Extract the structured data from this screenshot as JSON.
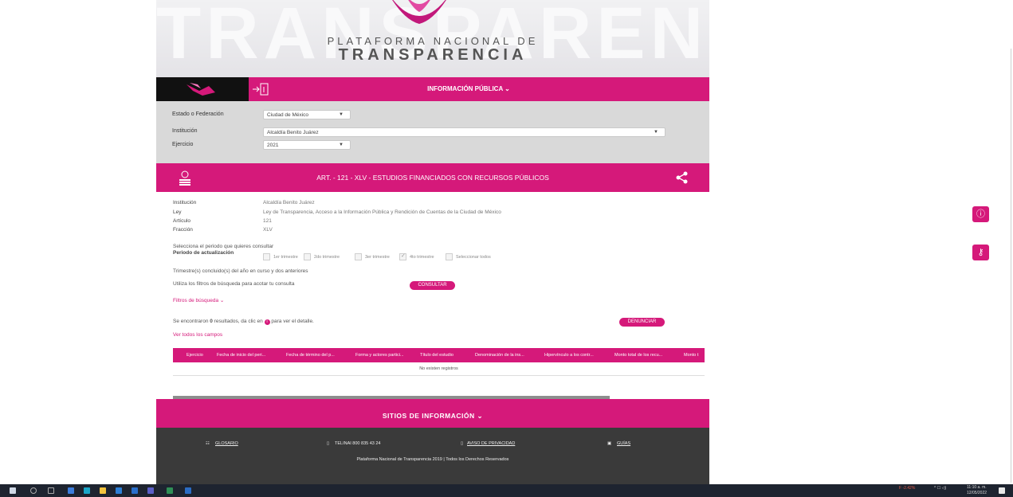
{
  "banner": {
    "bg_word": "TRANSPARENCIA",
    "line1": "PLATAFORMA NACIONAL DE",
    "line2": "TRANSPARENCIA"
  },
  "nav": {
    "menu_label": "INFORMACIÓN PÚBLICA ⌄"
  },
  "filters": {
    "estado_label": "Estado o Federación",
    "estado_value": "Ciudad de México",
    "institucion_label": "Institución",
    "institucion_value": "Alcaldía Benito Juárez",
    "ejercicio_label": "Ejercicio",
    "ejercicio_value": "2021"
  },
  "article": {
    "title": "ART. - 121 - XLV - ESTUDIOS FINANCIADOS CON RECURSOS PÚBLICOS"
  },
  "info": [
    {
      "label": "Institución",
      "value": "Alcaldía Benito Juárez"
    },
    {
      "label": "Ley",
      "value": "Ley de Transparencia, Acceso a la Información Pública y Rendición de Cuentas de la Ciudad de México"
    },
    {
      "label": "Artículo",
      "value": "121"
    },
    {
      "label": "Fracción",
      "value": "XLV"
    }
  ],
  "period": {
    "prompt": "Selecciona el periodo que quieres consultar",
    "label": "Periodo de actualización",
    "options": [
      "1er trimestre",
      "2do trimestre",
      "3er trimestre",
      "4to trimestre",
      "Seleccionar todos"
    ],
    "checked": [
      false,
      false,
      false,
      true,
      false
    ],
    "note": "Trimestre(s) concluido(s) del año en curso y dos anteriores"
  },
  "search": {
    "hint": "Utiliza los filtros de búsqueda para acotar tu consulta",
    "consult_button": "CONSULTAR",
    "filters_link": "Filtros de búsqueda ⌄"
  },
  "results": {
    "prefix": "Se encontraron",
    "count": "0",
    "suffix": "resultados, da clic en",
    "suffix2": "para ver el detalle.",
    "denounce_button": "DENUNCIAR",
    "all_fields_link": "Ver todos los campos"
  },
  "table": {
    "headers": [
      "Ejercicio",
      "Fecha de inicio del peri...",
      "Fecha de término del p...",
      "Forma y actores partici...",
      "Título del estudio",
      "Denominación de la ins...",
      "Hipervínculo a los contr...",
      "Monto total de los recu...",
      "Monto t"
    ],
    "empty": "No existen registros"
  },
  "sitios": {
    "label": "SITIOS DE INFORMACIÓN ⌄"
  },
  "footer": {
    "glosario": "GLOSARIO",
    "telinai": "TELINAI 800 835 43 24",
    "aviso": "AVISO DE PRIVACIDAD",
    "guias": "GUÍAS",
    "copyright": "Plataforma Nacional de Transparencia 2019 | Todos los Derechos Reservados"
  },
  "taskbar": {
    "stock": "F -2.42%",
    "time": "11:10 a. m.",
    "date": "12/05/2022"
  },
  "colors": {
    "brand": "#d5197a",
    "footer": "#3a3a3a",
    "filters_bg": "#d9d9d9"
  }
}
